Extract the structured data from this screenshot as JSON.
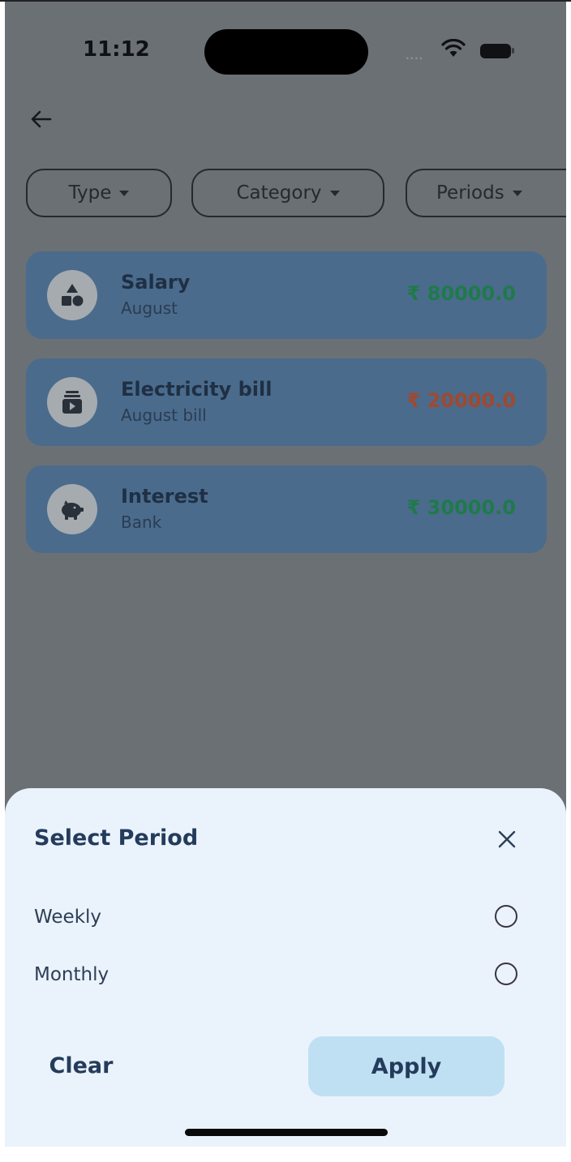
{
  "status_bar": {
    "time": "11:12"
  },
  "filters": [
    {
      "label": "Type"
    },
    {
      "label": "Category"
    },
    {
      "label": "Periods"
    }
  ],
  "transactions": [
    {
      "title": "Salary",
      "subtitle": "August",
      "amount": "₹ 80000.0",
      "amount_color": "#1f7a4a",
      "icon": "shapes-icon"
    },
    {
      "title": "Electricity bill",
      "subtitle": "August bill",
      "amount": "₹ 20000.0",
      "amount_color": "#a3482e",
      "icon": "inbox-icon"
    },
    {
      "title": "Interest",
      "subtitle": "Bank",
      "amount": "₹ 30000.0",
      "amount_color": "#1f7a4a",
      "icon": "piggy-bank-icon"
    }
  ],
  "sheet": {
    "title": "Select Period",
    "options": [
      {
        "label": "Weekly"
      },
      {
        "label": "Monthly"
      }
    ],
    "clear_label": "Clear",
    "apply_label": "Apply"
  },
  "colors": {
    "overlay": "#6b7075",
    "card": "#4a6b8c",
    "sheet": "#eaf3fc",
    "apply": "#bfe0f2",
    "income": "#1f7a4a",
    "expense": "#a3482e"
  }
}
